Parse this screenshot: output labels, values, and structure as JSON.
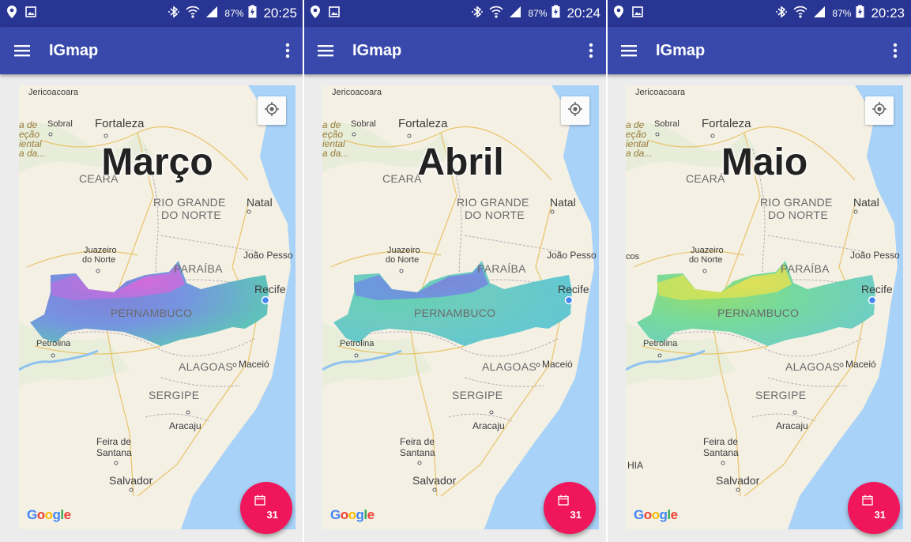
{
  "app": {
    "title": "IGmap"
  },
  "status_bar": {
    "battery_percent": "87%",
    "times": [
      "20:25",
      "20:24",
      "20:23"
    ]
  },
  "map": {
    "cities": {
      "jericoacoara": "Jericoacoara",
      "sobral": "Sobral",
      "fortaleza": "Fortaleza",
      "natal": "Natal",
      "juazeiro_line1": "Juazeiro",
      "juazeiro_line2": "do Norte",
      "joao_pessoa": "João Pesso",
      "recife": "Recife",
      "petrolina": "Petrolina",
      "maceio": "Maceió",
      "aracaju": "Aracaju",
      "feira_line1": "Feira de",
      "feira_line2": "Santana",
      "salvador": "Salvador",
      "cos": "cos",
      "hia": "HIA"
    },
    "states": {
      "ceara": "CEARÁ",
      "rn_line1": "RIO GRANDE",
      "rn_line2": "DO NORTE",
      "paraiba": "PARAÍBA",
      "pernambuco": "PERNAMBUCO",
      "alagoas": "ALAGOAS",
      "sergipe": "SERGIPE"
    },
    "edge_fragments": [
      "a de",
      "eção",
      "iental",
      "a da..."
    ],
    "attribution": "Google"
  },
  "panels": [
    {
      "month": "Março",
      "time": "20:25",
      "calendar_day": "31",
      "palette": "magenta-blue"
    },
    {
      "month": "Abril",
      "time": "20:24",
      "calendar_day": "31",
      "palette": "blue-green"
    },
    {
      "month": "Maio",
      "time": "20:23",
      "calendar_day": "31",
      "palette": "yellow-green"
    }
  ],
  "colors": {
    "status_bar": "#283593",
    "app_bar": "#3949ab",
    "fab": "#f0165b",
    "water": "#a8d2f7",
    "land": "#f4f0e4"
  }
}
